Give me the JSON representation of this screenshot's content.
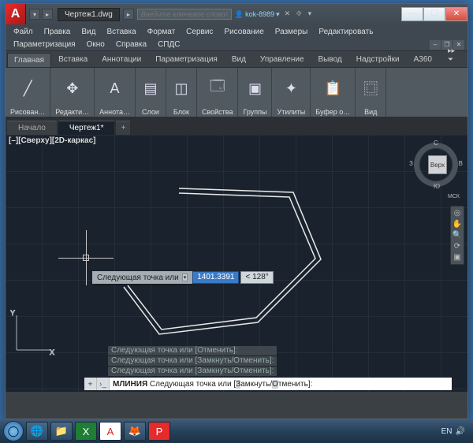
{
  "title": "Чертеж1.dwg",
  "search_placeholder": "Введите ключевое слово/фразу",
  "user": "kok-8989",
  "menu1": [
    "Файл",
    "Правка",
    "Вид",
    "Вставка",
    "Формат",
    "Сервис",
    "Рисование",
    "Размеры",
    "Редактировать"
  ],
  "menu2": [
    "Параметризация",
    "Окно",
    "Справка",
    "СПДС"
  ],
  "ribbon_tabs": [
    "Главная",
    "Вставка",
    "Аннотации",
    "Параметризация",
    "Вид",
    "Управление",
    "Вывод",
    "Надстройки",
    "A360"
  ],
  "ribbon_panels": [
    {
      "label": "Рисован…",
      "icon": "╱"
    },
    {
      "label": "Редакти…",
      "icon": "✥"
    },
    {
      "label": "Аннота…",
      "icon": "A"
    },
    {
      "label": "Слои",
      "icon": "▤"
    },
    {
      "label": "Блок",
      "icon": "◫"
    },
    {
      "label": "Свойства",
      "icon": "🗔"
    },
    {
      "label": "Группы",
      "icon": "▣"
    },
    {
      "label": "Утилиты",
      "icon": "✦"
    },
    {
      "label": "Буфер о…",
      "icon": "📋"
    },
    {
      "label": "Вид",
      "icon": "⿴"
    }
  ],
  "doc_tabs": [
    {
      "label": "Начало",
      "active": false
    },
    {
      "label": "Чертеж1*",
      "active": true
    }
  ],
  "viewport_label": "[–][Сверху][2D-каркас]",
  "viewcube": {
    "face": "Верх",
    "n": "С",
    "s": "Ю",
    "e": "В",
    "w": "З",
    "region": "МСК"
  },
  "dynamic_prompt": {
    "label": "Следующая точка или",
    "value": "1401.3391",
    "angle": "< 128°"
  },
  "ucs": {
    "x": "X",
    "y": "Y"
  },
  "cmd_history": [
    "Следующая точка или [Отменить]:",
    "Следующая точка или [Замкнуть/Отменить]:",
    "Следующая точка или [Замкнуть/Отменить]:"
  ],
  "cmd_line": {
    "cmd": "МЛИНИЯ",
    "rest": " Следующая точка или [",
    "opt1": "З",
    "opt2": "амкнуть/",
    "opt3": "О",
    "opt4": "тменить]:"
  },
  "taskbar_apps": [
    "◯",
    "🌐",
    "📁",
    "X",
    "A",
    "🦊",
    "P"
  ],
  "tray_lang": "EN"
}
